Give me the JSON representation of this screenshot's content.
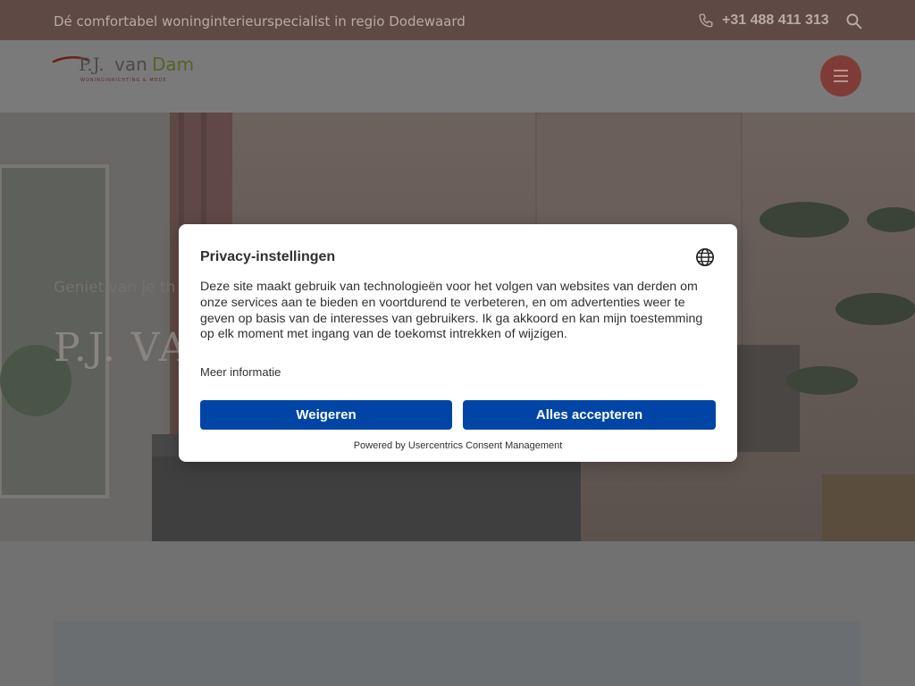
{
  "topbar": {
    "tagline": "Dé comfortabel woninginterieurspecialist in regio Dodewaard",
    "phone": "+31 488 411 313",
    "phone_icon": "phone-icon",
    "search_icon": "search-icon"
  },
  "header": {
    "logo_text": "P.J. van Dam",
    "logo_subtext": "WONINGINRICHTING & MODE",
    "menu_icon": "hamburger-menu-icon"
  },
  "hero": {
    "subtitle": "Geniet van je th",
    "title": "P.J. VA"
  },
  "consent": {
    "title": "Privacy-instellingen",
    "globe_icon": "globe-icon",
    "description": "Deze site maakt gebruik van technologieën voor het volgen van websites van derden om onze services aan te bieden en voortdurend te verbeteren, en om advertenties weer te geven op basis van de interesses van gebruikers. Ik ga akkoord en kan mijn toestemming op elk moment met ingang van de toekomst intrekken of wijzigen.",
    "more_info": "Meer informatie",
    "deny_label": "Weigeren",
    "accept_label": "Alles accepteren",
    "powered_by": "Powered by Usercentrics Consent Management"
  },
  "colors": {
    "topbar": "#5e4944",
    "accent_button": "#0045a5",
    "menu_button": "#7f3c36"
  }
}
